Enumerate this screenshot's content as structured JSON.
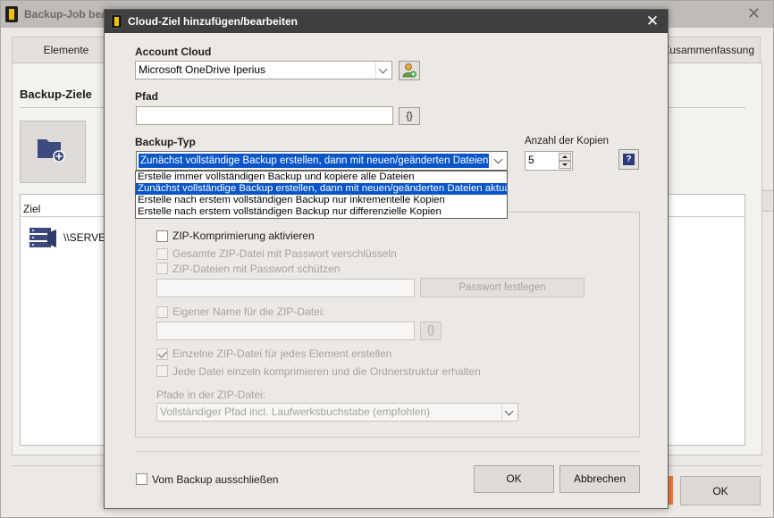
{
  "background_window": {
    "title": "Backup-Job bea",
    "tabs": [
      "Elemente",
      "Zusammenfassung"
    ],
    "section_title": "Backup-Ziele",
    "list_column": "Ziel",
    "row_text": "\\\\SERVER",
    "ok_label": "OK"
  },
  "dialog": {
    "title": "Cloud-Ziel hinzufügen/bearbeiten",
    "account_label": "Account Cloud",
    "account_value": "Microsoft OneDrive Iperius",
    "path_label": "Pfad",
    "path_value": "",
    "braces_label": "{}",
    "backup_type_label": "Backup-Typ",
    "backup_type_selected": "Zunächst vollständige Backup erstellen, dann mit neuen/geänderten Dateien aktualisieren",
    "backup_type_options": [
      "Erstelle immer vollständigen Backup und kopiere alle Dateien",
      "Zunächst vollständige Backup erstellen, dann mit neuen/geänderten Dateien aktualisieren",
      "Erstelle nach erstem vollständigen Backup nur inkrementelle Kopien",
      "Erstelle nach erstem vollständigen Backup nur differenzielle Kopien"
    ],
    "backup_type_selected_index": 1,
    "copies_label": "Anzahl der Kopien",
    "copies_value": "5",
    "help_label": "?",
    "zip": {
      "compress_label": "ZIP-Komprimierung aktivieren",
      "encrypt_label": "Gesamte ZIP-Datei mit Passwort verschlüsseln",
      "protect_label": "ZIP-Dateien mit Passwort schützen",
      "password_button": "Passwort festlegen",
      "custom_name_label": "Eigener Name für die ZIP-Datei:",
      "single_zip_label": "Einzelne ZIP-Datei für jedes Element erstellen",
      "each_file_label": "Jede Datei einzeln komprimieren und die Ordnerstruktur erhalten",
      "paths_label": "Pfade in der ZIP-Datei:",
      "paths_value": "Vollständiger Pfad incl. Laufwerksbuchstabe (empfohlen)"
    },
    "exclude_label": "Vom Backup ausschließen",
    "ok_label": "OK",
    "cancel_label": "Abbrechen"
  },
  "colors": {
    "selection": "#0a56c9",
    "titlebar": "#3f3f3f",
    "accent_orange": "#f07a3c"
  }
}
